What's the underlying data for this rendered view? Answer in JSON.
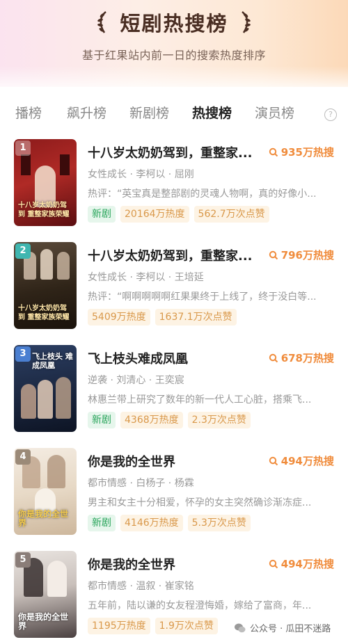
{
  "header": {
    "title": "短剧热搜榜",
    "subtitle": "基于红果站内前一日的搜索热度排序"
  },
  "tabs": [
    {
      "label": "播榜"
    },
    {
      "label": "飙升榜"
    },
    {
      "label": "新剧榜"
    },
    {
      "label": "热搜榜"
    },
    {
      "label": "演员榜"
    }
  ],
  "active_tab": "热搜榜",
  "help_label": "?",
  "items": [
    {
      "rank": "1",
      "title": "十八岁太奶奶驾到，重整家...",
      "heat": "935万热搜",
      "meta": "女性成长 · 李柯以 · 屈刚",
      "desc": "热评：“英宝真是整部剧的灵魂人物啊，真的好像小...",
      "tag_new": "新剧",
      "heat_stat": "20164万热度",
      "likes": "562.7万次点赞",
      "poster_text": "十八岁太奶奶驾到 重整家族荣耀"
    },
    {
      "rank": "2",
      "title": "十八岁太奶奶驾到，重整家...",
      "heat": "796万热搜",
      "meta": "女性成长 · 李柯以 · 王培延",
      "desc": "热评：“啊啊啊啊啊红果果终于上线了，终于没白等...",
      "tag_new": "",
      "heat_stat": "5409万热度",
      "likes": "1637.1万次点赞",
      "poster_text": "十八岁太奶奶驾到 重整家族荣耀"
    },
    {
      "rank": "3",
      "title": "飞上枝头难成凤凰",
      "heat": "678万热搜",
      "meta": "逆袭 · 刘清心 · 王奕宸",
      "desc": "林惠兰带上研究了数年的新一代人工心脏，搭乘飞...",
      "tag_new": "新剧",
      "heat_stat": "4368万热度",
      "likes": "2.3万次点赞",
      "poster_text": "飞上枝头 难成凤凰"
    },
    {
      "rank": "4",
      "title": "你是我的全世界",
      "heat": "494万热搜",
      "meta": "都市情感 · 白杨子 · 杨霖",
      "desc": "男主和女主十分相爱，怀孕的女主突然确诊渐冻症...",
      "tag_new": "新剧",
      "heat_stat": "4146万热度",
      "likes": "5.3万次点赞",
      "poster_text": "你是我的全世界"
    },
    {
      "rank": "5",
      "title": "你是我的全世界",
      "heat": "494万热搜",
      "meta": "都市情感 · 温叙 · 崔家铭",
      "desc": "五年前，陆以谦的女友程澄悔婚，嫁给了富商，年...",
      "tag_new": "",
      "heat_stat": "1195万热度",
      "likes": "1.9万次点赞",
      "poster_text": "你是我的全世界"
    }
  ],
  "watermark": "公众号 · 瓜田不迷路",
  "colors": {
    "accent_orange": "#f08c3c",
    "tag_green": "#2aa55c",
    "title_brown": "#4a2e23"
  }
}
